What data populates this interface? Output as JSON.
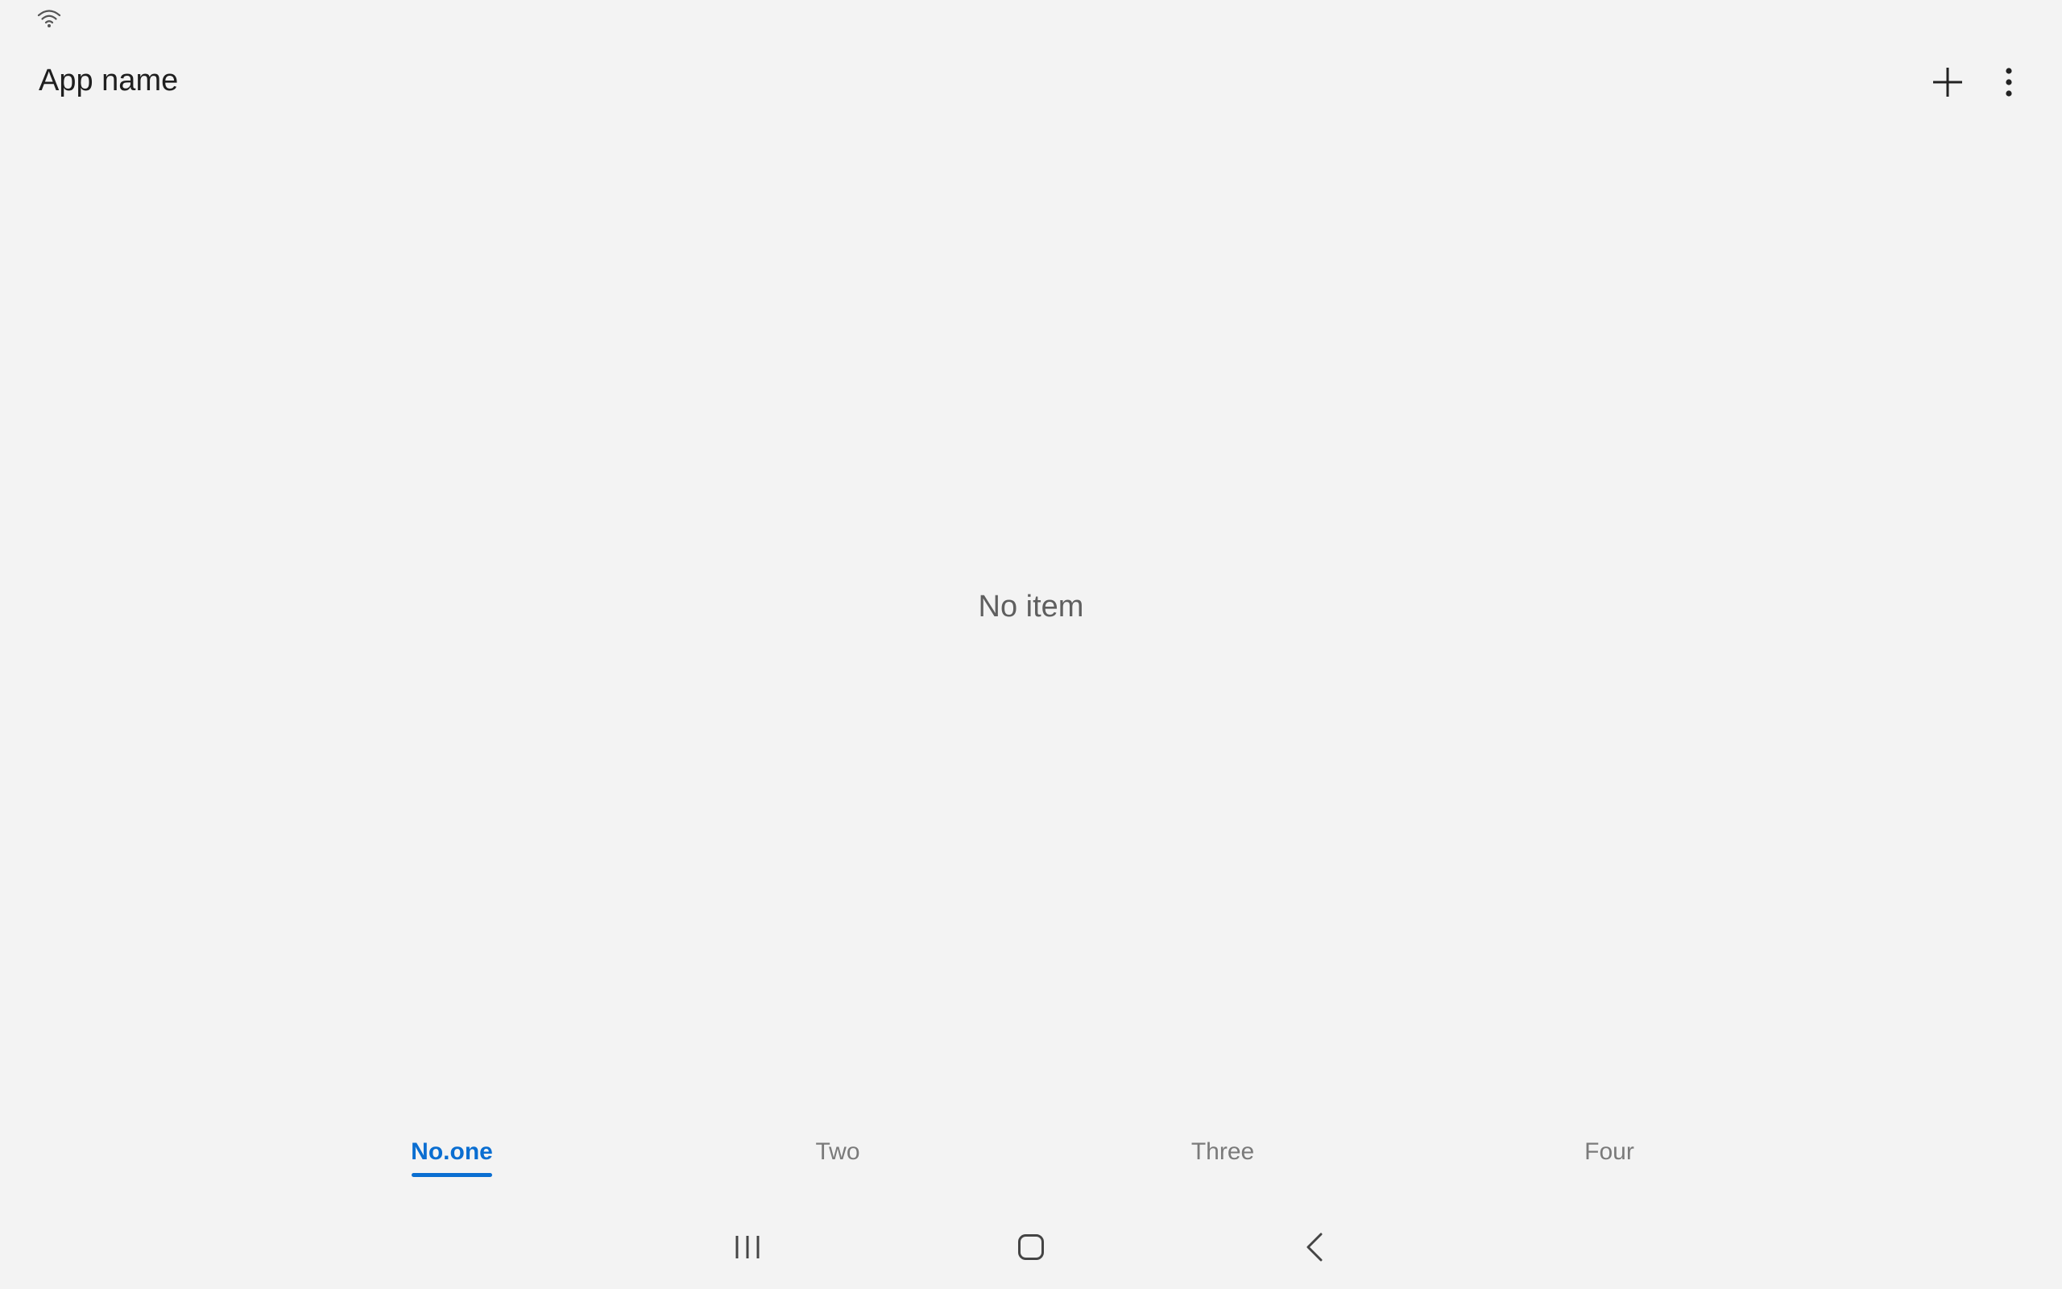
{
  "status_bar": {
    "icons": [
      "wifi-icon"
    ]
  },
  "app_bar": {
    "title": "App name",
    "actions": [
      "plus-icon",
      "more-vertical-icon"
    ]
  },
  "content": {
    "empty_message": "No item"
  },
  "tabs": [
    {
      "label": "No.one",
      "active": true
    },
    {
      "label": "Two",
      "active": false
    },
    {
      "label": "Three",
      "active": false
    },
    {
      "label": "Four",
      "active": false
    }
  ],
  "nav_bar": {
    "buttons": [
      "recent-apps-icon",
      "home-icon",
      "back-icon"
    ]
  },
  "colors": {
    "background": "#f3f3f3",
    "accent": "#0a6ed1",
    "inactive_tab": "#7a7a7a",
    "empty_text": "#5f5f5f"
  }
}
